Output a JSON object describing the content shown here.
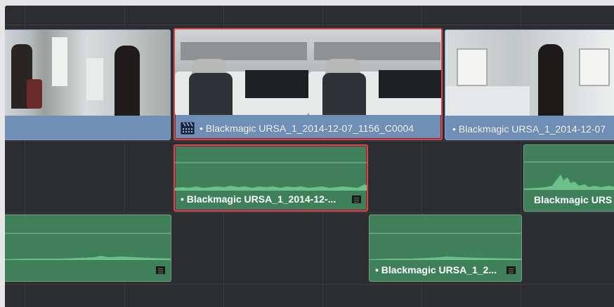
{
  "timeline": {
    "video_track": {
      "clips": [
        {
          "name": "",
          "selected": false
        },
        {
          "name": "Blackmagic URSA_1_2014-12-07_1156_C0004",
          "selected": true,
          "icon": "clapperboard-icon"
        },
        {
          "name": "Blackmagic URSA_1_2014-12-07",
          "selected": false
        }
      ]
    },
    "audio_track_1": {
      "clips": [
        {
          "name": "Blackmagic URSA_1_2014-12-...",
          "selected": true
        },
        {
          "name": "Blackmagic URS",
          "selected": false
        }
      ]
    },
    "audio_track_2": {
      "clips": [
        {
          "name": "",
          "selected": false
        },
        {
          "name": "Blackmagic URSA_1_2...",
          "selected": false
        }
      ]
    }
  },
  "colors": {
    "video_clip": "#6f8fb7",
    "audio_clip": "#3f7f5a",
    "selection": "#d9464d",
    "track_background": "#1f2124"
  }
}
